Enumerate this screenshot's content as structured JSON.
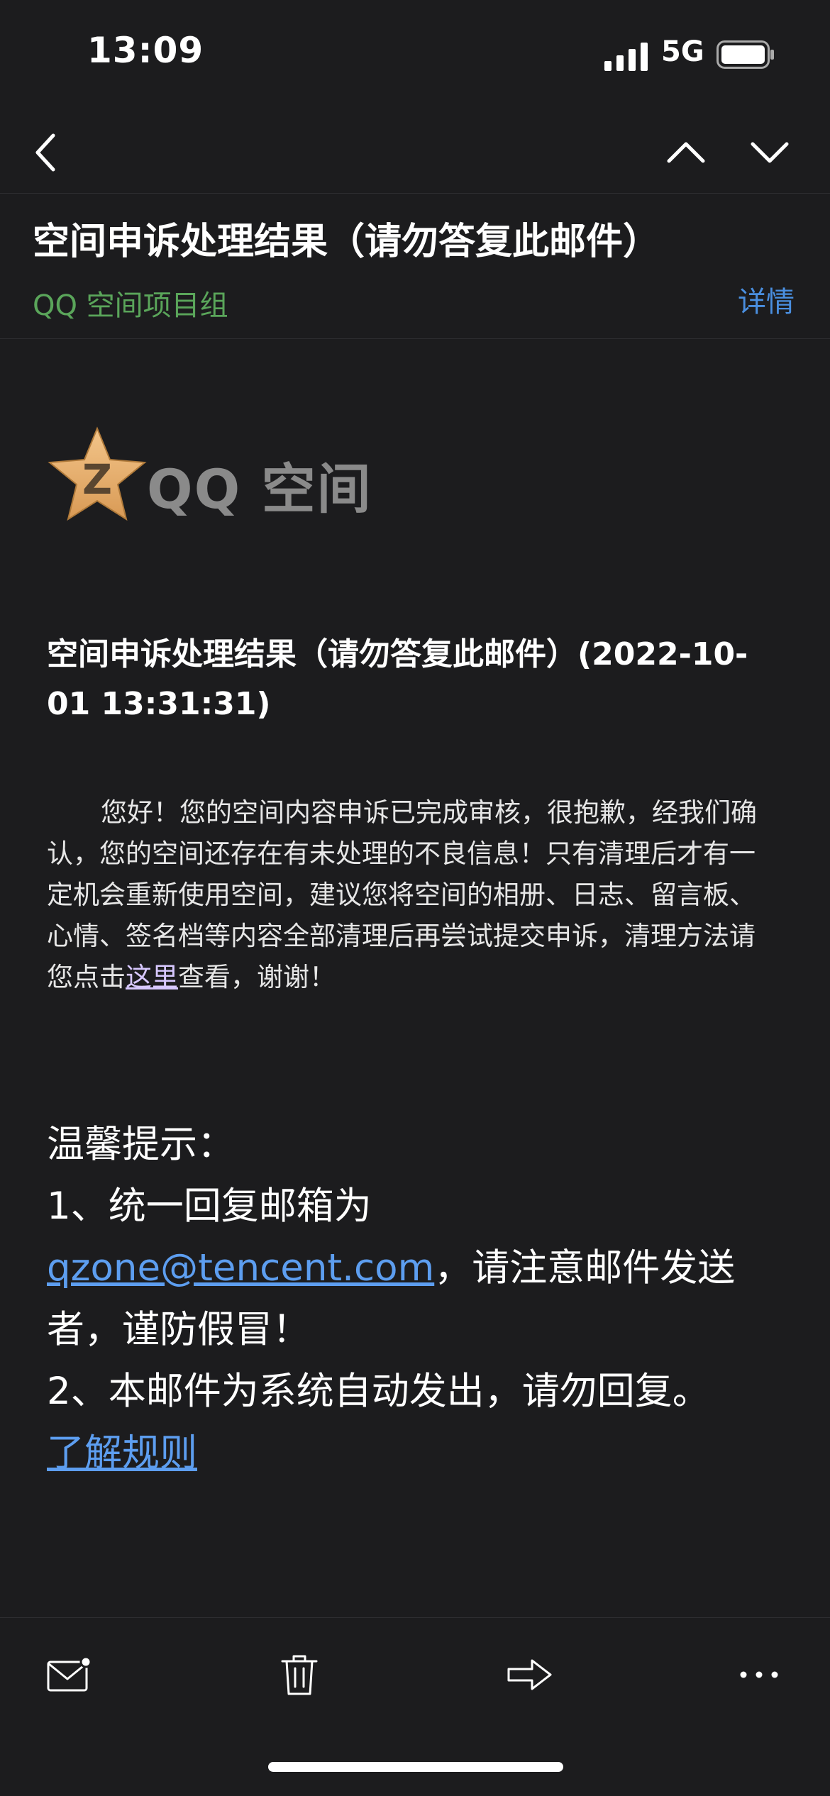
{
  "status_bar": {
    "time": "13:09",
    "network": "5G",
    "icons": [
      "signal-icon",
      "battery-icon"
    ]
  },
  "nav": {
    "icons": [
      "chevron-left-icon",
      "chevron-up-icon",
      "chevron-down-icon"
    ]
  },
  "header": {
    "subject": "空间申诉处理结果（请勿答复此邮件）",
    "sender": "QQ 空间项目组",
    "details_label": "详情",
    "sender_color": "#5aa55a",
    "link_color": "#4a8fe0"
  },
  "logo": {
    "text": "QQ 空间",
    "icon": "qq-zone-star-icon"
  },
  "body": {
    "title": "空间申诉处理结果（请勿答复此邮件）(2022-10-01 13:31:31)",
    "paragraph_before": "您好！您的空间内容申诉已完成审核，很抱歉，经我们确认，您的空间还存在有未处理的不良信息！只有清理后才有一定机会重新使用空间，建议您将空间的相册、日志、留言板、心情、签名档等内容全部清理后再尝试提交申诉，清理方法请您点击",
    "link_text": "这里",
    "paragraph_after": "查看，谢谢！",
    "tips_heading": "温馨提示：",
    "tip1_prefix": "1、统一回复邮箱为",
    "tip1_email": "qzone@tencent.com",
    "tip1_suffix": "，请注意邮件发送者，谨防假冒！",
    "tip2": "2、本邮件为系统自动发出，请勿回复。",
    "rules_link": "了解规则"
  },
  "toolbar": {
    "icons": [
      "mark-unread-icon",
      "trash-icon",
      "forward-icon",
      "more-icon"
    ]
  }
}
